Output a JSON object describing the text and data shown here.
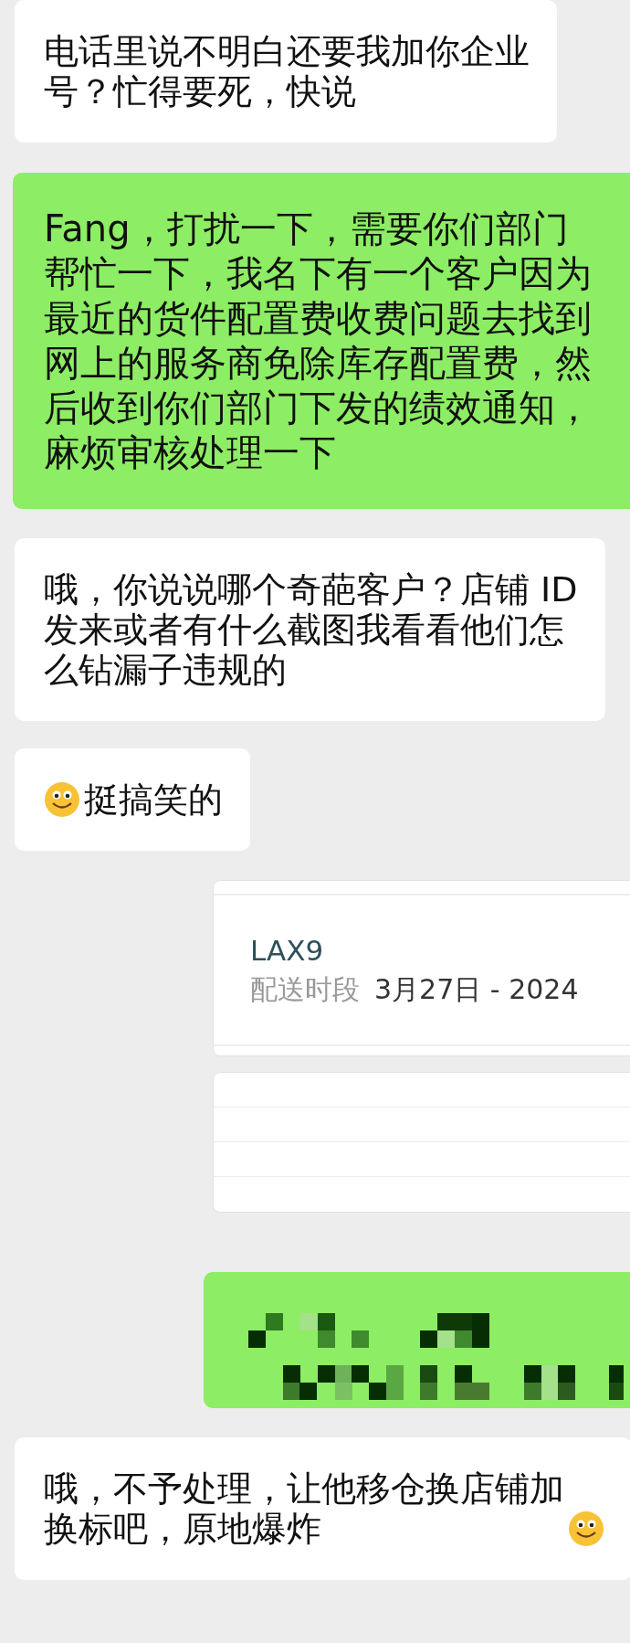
{
  "messages": [
    {
      "kind": "text",
      "outgoing": false,
      "content": [
        {
          "kind": "text",
          "lines": [
            "电话里说不明白还要我加你企业",
            "号？忙得要死，快说"
          ]
        }
      ]
    },
    {
      "kind": "text",
      "outgoing": true,
      "content": [
        {
          "kind": "text",
          "lines": [
            "Fang，打扰一下，需要你们部门",
            "帮忙一下，我名下有一个客户因为",
            "最近的货件配置费收费问题去找到",
            "网上的服务商免除库存配置费，然",
            "后收到你们部门下发的绩效通知，",
            "麻烦审核处理一下"
          ]
        }
      ]
    },
    {
      "kind": "text",
      "outgoing": false,
      "content": [
        {
          "kind": "text",
          "lines": [
            "哦，你说说哪个奇葩客户？店铺 ID",
            "发来或者有什么截图我看看他们怎",
            "么钻漏子违规的"
          ]
        }
      ]
    },
    {
      "kind": "text",
      "outgoing": false,
      "content": [
        {
          "kind": "emoji"
        },
        {
          "kind": "text",
          "lines": [
            "挺搞笑的"
          ]
        }
      ]
    },
    {
      "kind": "shipment_card",
      "outgoing": true,
      "site": "LAX9",
      "label": "配送时段",
      "date": "3月27日 - 2024"
    },
    {
      "kind": "blank_card",
      "outgoing": true
    },
    {
      "kind": "mosaic",
      "outgoing": true
    },
    {
      "kind": "text",
      "outgoing": false,
      "content": [
        {
          "kind": "text",
          "lines": [
            "哦，不予处理，让他移仓换店铺加",
            "换标吧，原地爆炸"
          ]
        },
        {
          "kind": "emoji"
        }
      ]
    }
  ]
}
